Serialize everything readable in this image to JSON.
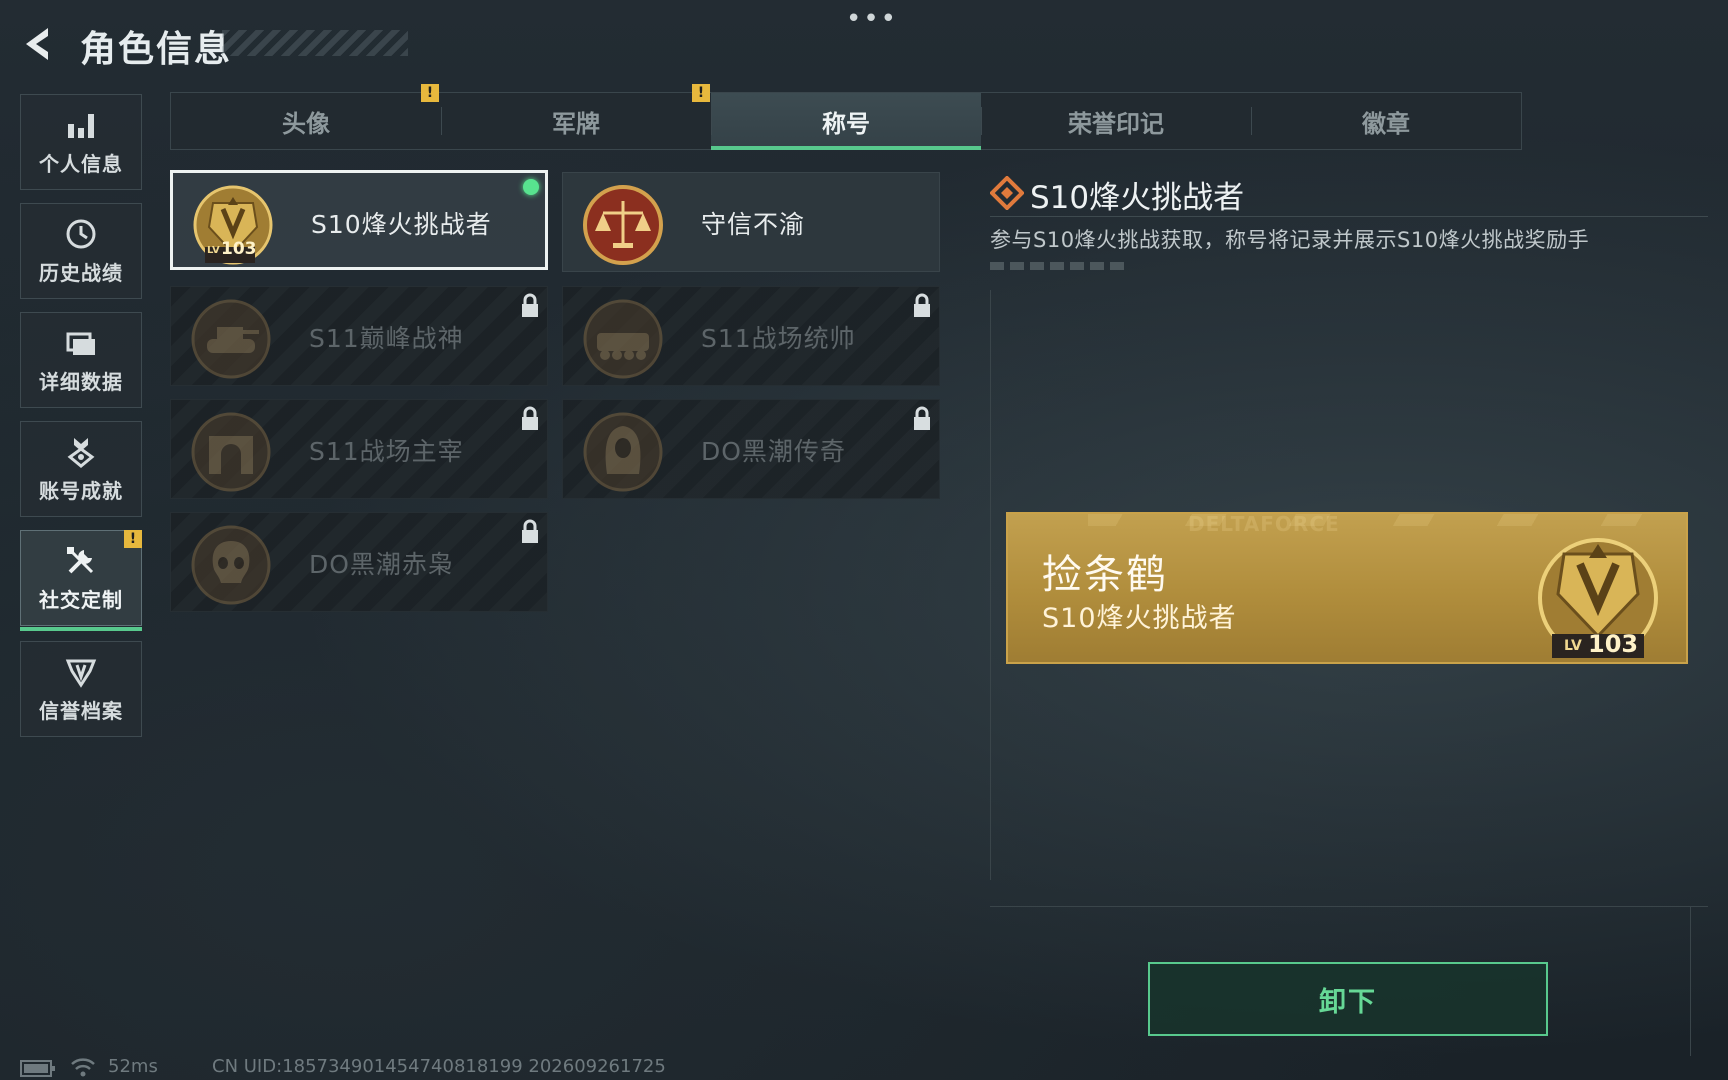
{
  "header": {
    "title": "角色信息"
  },
  "sidebar": {
    "items": [
      {
        "label": "个人信息",
        "icon": "bar-chart-icon"
      },
      {
        "label": "历史战绩",
        "icon": "clock-icon"
      },
      {
        "label": "详细数据",
        "icon": "folder-icon"
      },
      {
        "label": "账号成就",
        "icon": "achievement-icon"
      },
      {
        "label": "社交定制",
        "icon": "tools-icon",
        "active": true,
        "badge": "!"
      },
      {
        "label": "信誉档案",
        "icon": "credit-shield-icon"
      }
    ]
  },
  "tabs": [
    {
      "label": "头像",
      "badge": "!"
    },
    {
      "label": "军牌",
      "badge": "!"
    },
    {
      "label": "称号",
      "active": true
    },
    {
      "label": "荣誉印记"
    },
    {
      "label": "徽章"
    }
  ],
  "titles": [
    {
      "label": "S10烽火挑战者",
      "emblem_level": "103",
      "selected": true,
      "equipped": true
    },
    {
      "label": "守信不渝"
    },
    {
      "label": "S11巅峰战神",
      "locked": true
    },
    {
      "label": "S11战场统帅",
      "locked": true
    },
    {
      "label": "S11战场主宰",
      "locked": true
    },
    {
      "label": "DO黑潮传奇",
      "locked": true
    },
    {
      "label": "DO黑潮赤枭",
      "locked": true
    }
  ],
  "detail": {
    "title": "S10烽火挑战者",
    "description": "参与S10烽火挑战获取，称号将记录并展示S10烽火挑战奖励手"
  },
  "nameplate": {
    "player_name": "捡条鹤",
    "title": "S10烽火挑战者",
    "watermark": "DELTAFORCE",
    "level_label": "LV",
    "level": "103"
  },
  "actions": {
    "unequip_label": "卸下"
  },
  "status": {
    "ping": "52ms",
    "uid": "CN UID:185734901454740818199 202609261725"
  },
  "colors": {
    "accent_green": "#58c98d",
    "gold": "#c2a04f",
    "warning": "#e7b83d"
  }
}
